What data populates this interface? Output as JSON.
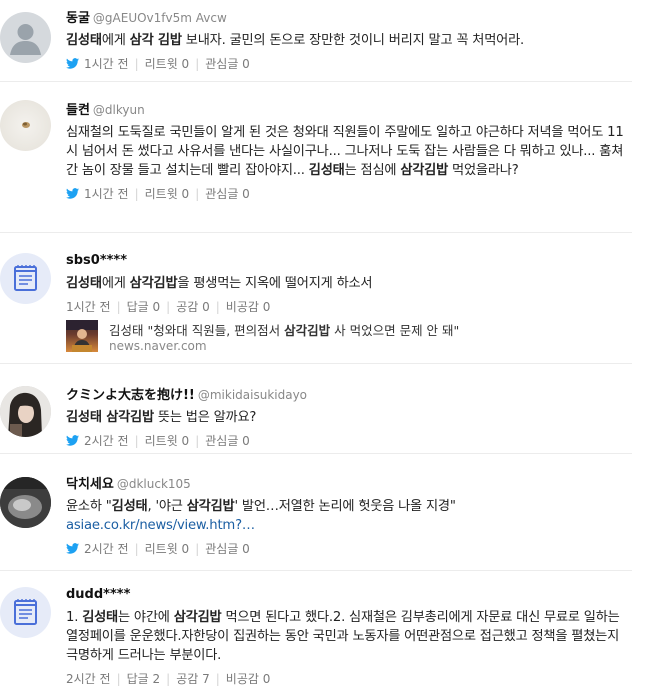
{
  "posts": [
    {
      "nickname": "동굴",
      "handle": "@gAEUOv1fv5m Avcw",
      "text_parts": [
        {
          "t": "김성태",
          "b": true
        },
        {
          "t": "에게 ",
          "b": false
        },
        {
          "t": "삼각 김밥",
          "b": true
        },
        {
          "t": " 보내자. 굴민의 돈으로 장만한 것이니 버리지 말고 꼭 처먹어라.",
          "b": false
        }
      ],
      "time": "1시간 전",
      "retweet_label": "리트윗 0",
      "like_label": "관심글 0"
    },
    {
      "nickname": "들켠",
      "handle": "@dlkyun",
      "text_parts": [
        {
          "t": "심재철의 도둑질로 국민들이 알게 된 것은 청와대 직원들이 주말에도 일하고 야근하다 저녁을 먹어도 11시 넘어서 돈 썼다고 사유서를 낸다는 사실이구나... 그나저나 도둑 잡는 사람들은 다 뭐하고 있나... 훔쳐간 놈이 장물 들고 설치는데 빨리 잡아야지... ",
          "b": false
        },
        {
          "t": "김성태",
          "b": true
        },
        {
          "t": "는 점심에 ",
          "b": false
        },
        {
          "t": "삼각김밥",
          "b": true
        },
        {
          "t": " 먹었을라나?",
          "b": false
        }
      ],
      "time": "1시간 전",
      "retweet_label": "리트윗 0",
      "like_label": "관심글 0"
    },
    {
      "nickname": "sbs0****",
      "handle": "",
      "text_parts": [
        {
          "t": "김성태",
          "b": true
        },
        {
          "t": "에게 ",
          "b": false
        },
        {
          "t": "삼각김밥",
          "b": true
        },
        {
          "t": "을 평생먹는 지옥에 떨어지게 하소서",
          "b": false
        }
      ],
      "time": "1시간 전",
      "reply_label": "답글 0",
      "agree_label": "공감 0",
      "disagree_label": "비공감 0",
      "news_title_pre": "김성태",
      "news_title_mid": " \"청와대 직원들, 편의점서 ",
      "news_title_bold": "삼각김밥",
      "news_title_post": " 사 먹었으면 문제 안 돼\"",
      "news_source": "news.naver.com"
    },
    {
      "nickname": "クミンよ大志を抱け!!",
      "handle": "@mikidaisukidayo",
      "text_parts": [
        {
          "t": "김성태 삼각김밥",
          "b": true
        },
        {
          "t": " 뜻는 법은 알까요?",
          "b": false
        }
      ],
      "time": "2시간 전",
      "retweet_label": "리트윗 0",
      "like_label": "관심글 0"
    },
    {
      "nickname": "닥치세요",
      "handle": "@dkluck105",
      "text_parts": [
        {
          "t": "윤소하 \"",
          "b": false
        },
        {
          "t": "김성태",
          "b": true
        },
        {
          "t": ", '야근 ",
          "b": false
        },
        {
          "t": "삼각김밥",
          "b": true
        },
        {
          "t": "' 발언…저열한 논리에 헛웃음 나올 지경\" ",
          "b": false
        },
        {
          "t": "asiae.co.kr/news/view.htm?…",
          "b": false,
          "link": true
        }
      ],
      "time": "2시간 전",
      "retweet_label": "리트윗 0",
      "like_label": "관심글 0"
    },
    {
      "nickname": "dudd****",
      "handle": "",
      "text_parts": [
        {
          "t": "1. ",
          "b": false
        },
        {
          "t": "김성태",
          "b": true
        },
        {
          "t": "는 야간에 ",
          "b": false
        },
        {
          "t": "삼각김밥",
          "b": true
        },
        {
          "t": " 먹으면 된다고 했다.2. 심재철은 김부총리에게 자문료 대신 무료로 일하는 열정페이를 운운했다.자한당이 집권하는 동안 국민과 노동자를 어떤관점으로 접근했고 정책을 펼쳤는지 극명하게 드러나는 부분이다.",
          "b": false
        }
      ],
      "time": "2시간 전",
      "reply_label": "답글 2",
      "agree_label": "공감 7",
      "disagree_label": "비공감 0"
    }
  ],
  "colors": {
    "twitter_blue": "#1da1f2",
    "naver_blue": "#4a6fd9",
    "bold_text": "#111111",
    "meta_gray": "#7a7a7a",
    "link_blue": "#1c5fa3"
  },
  "icons": [
    "default-avatar-icon",
    "twitter-bird-icon",
    "newspaper-icon"
  ]
}
